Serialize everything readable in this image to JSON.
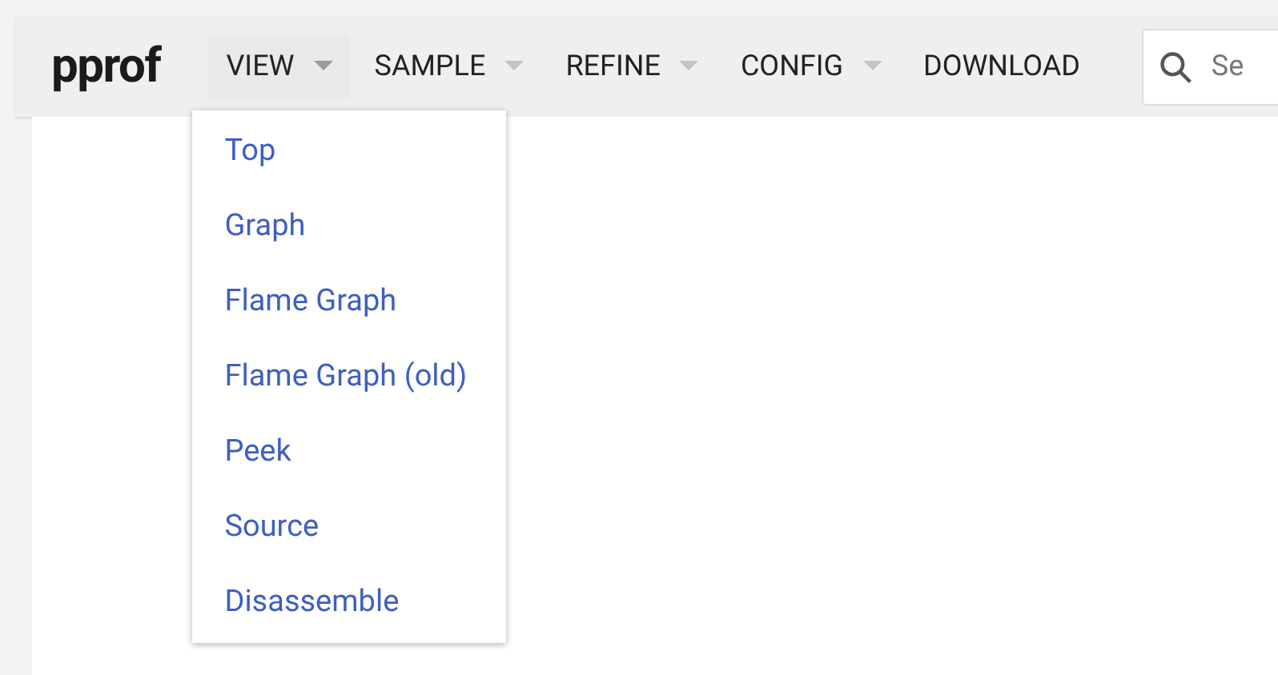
{
  "app_title": "pprof",
  "menus": [
    {
      "label": "VIEW",
      "kind": "dropdown",
      "expanded": true
    },
    {
      "label": "SAMPLE",
      "kind": "dropdown",
      "expanded": false
    },
    {
      "label": "REFINE",
      "kind": "dropdown",
      "expanded": false
    },
    {
      "label": "CONFIG",
      "kind": "dropdown",
      "expanded": false
    },
    {
      "label": "DOWNLOAD",
      "kind": "link"
    }
  ],
  "search": {
    "placeholder": "Se"
  },
  "view_menu": {
    "items": [
      "Top",
      "Graph",
      "Flame Graph",
      "Flame Graph (old)",
      "Peek",
      "Source",
      "Disassemble"
    ]
  }
}
